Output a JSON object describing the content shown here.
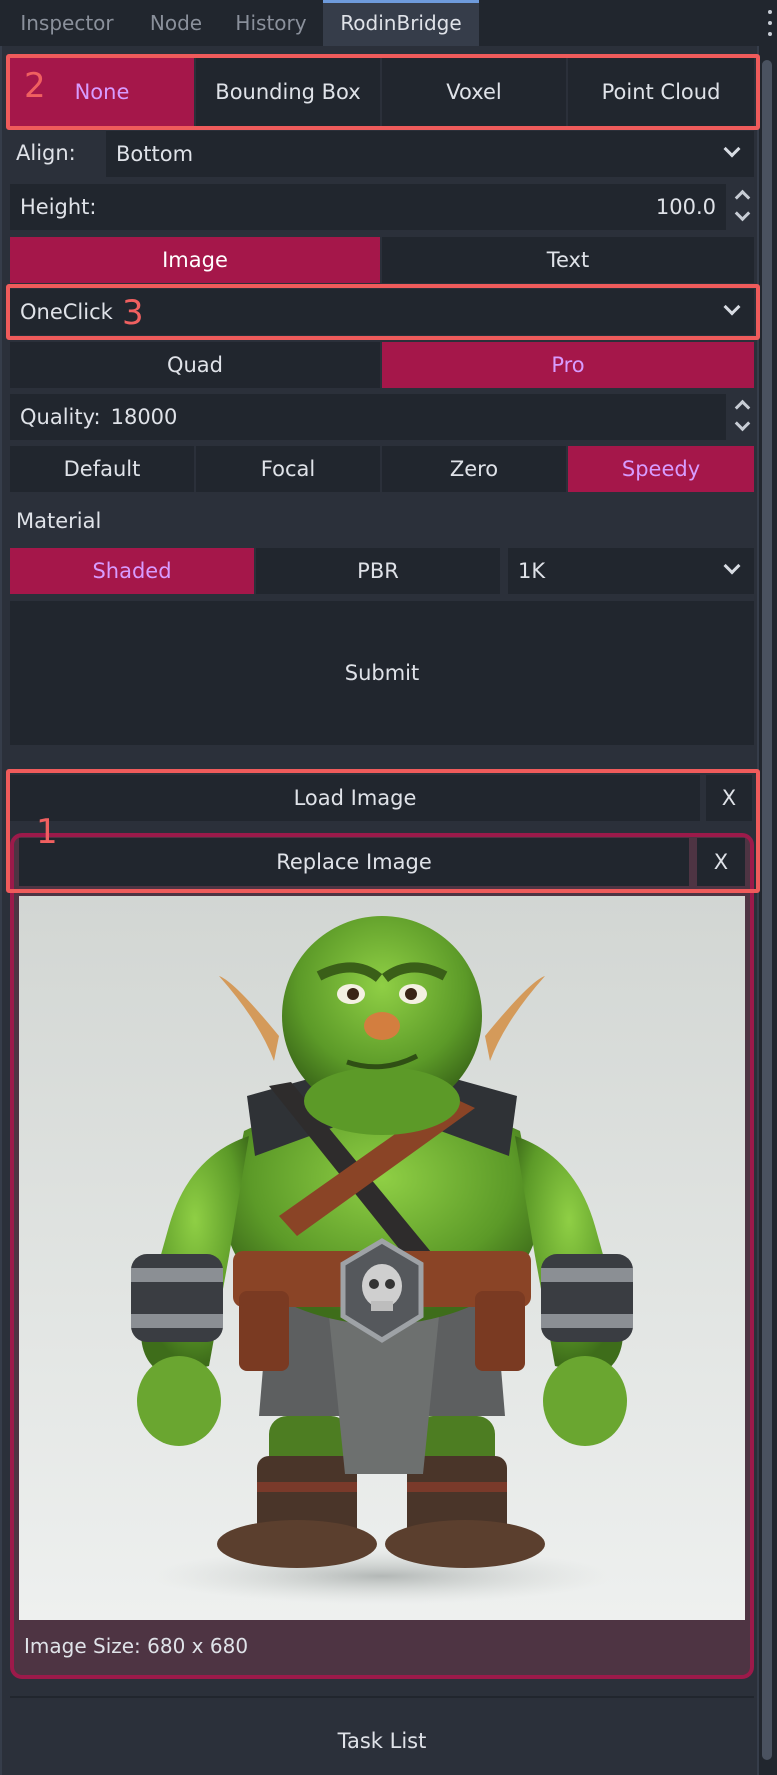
{
  "tabs": {
    "inspector": "Inspector",
    "node": "Node",
    "history": "History",
    "rodin": "RodinBridge"
  },
  "bbox_modes": [
    "None",
    "Bounding Box",
    "Voxel",
    "Point Cloud"
  ],
  "align": {
    "label": "Align:",
    "value": "Bottom"
  },
  "height": {
    "label": "Height:",
    "value": "100.0"
  },
  "input_mode": [
    "Image",
    "Text"
  ],
  "preset": {
    "value": "OneClick"
  },
  "mesh_mode": [
    "Quad",
    "Pro"
  ],
  "quality": {
    "label": "Quality:",
    "value": "18000"
  },
  "speed_modes": [
    "Default",
    "Focal",
    "Zero",
    "Speedy"
  ],
  "material": {
    "label": "Material",
    "options": [
      "Shaded",
      "PBR"
    ],
    "resolution": "1K"
  },
  "submit_label": "Submit",
  "load_image_label": "Load Image",
  "replace_image_label": "Replace Image",
  "close_label": "X",
  "image_size_text": "Image Size: 680 x 680",
  "task_list_label": "Task List",
  "annotations": {
    "n1": "1",
    "n2": "2",
    "n3": "3"
  },
  "colors": {
    "accent": "#a5174a",
    "annotation": "#ef5b5b",
    "panel": "#2b303a",
    "button": "#21262e"
  }
}
